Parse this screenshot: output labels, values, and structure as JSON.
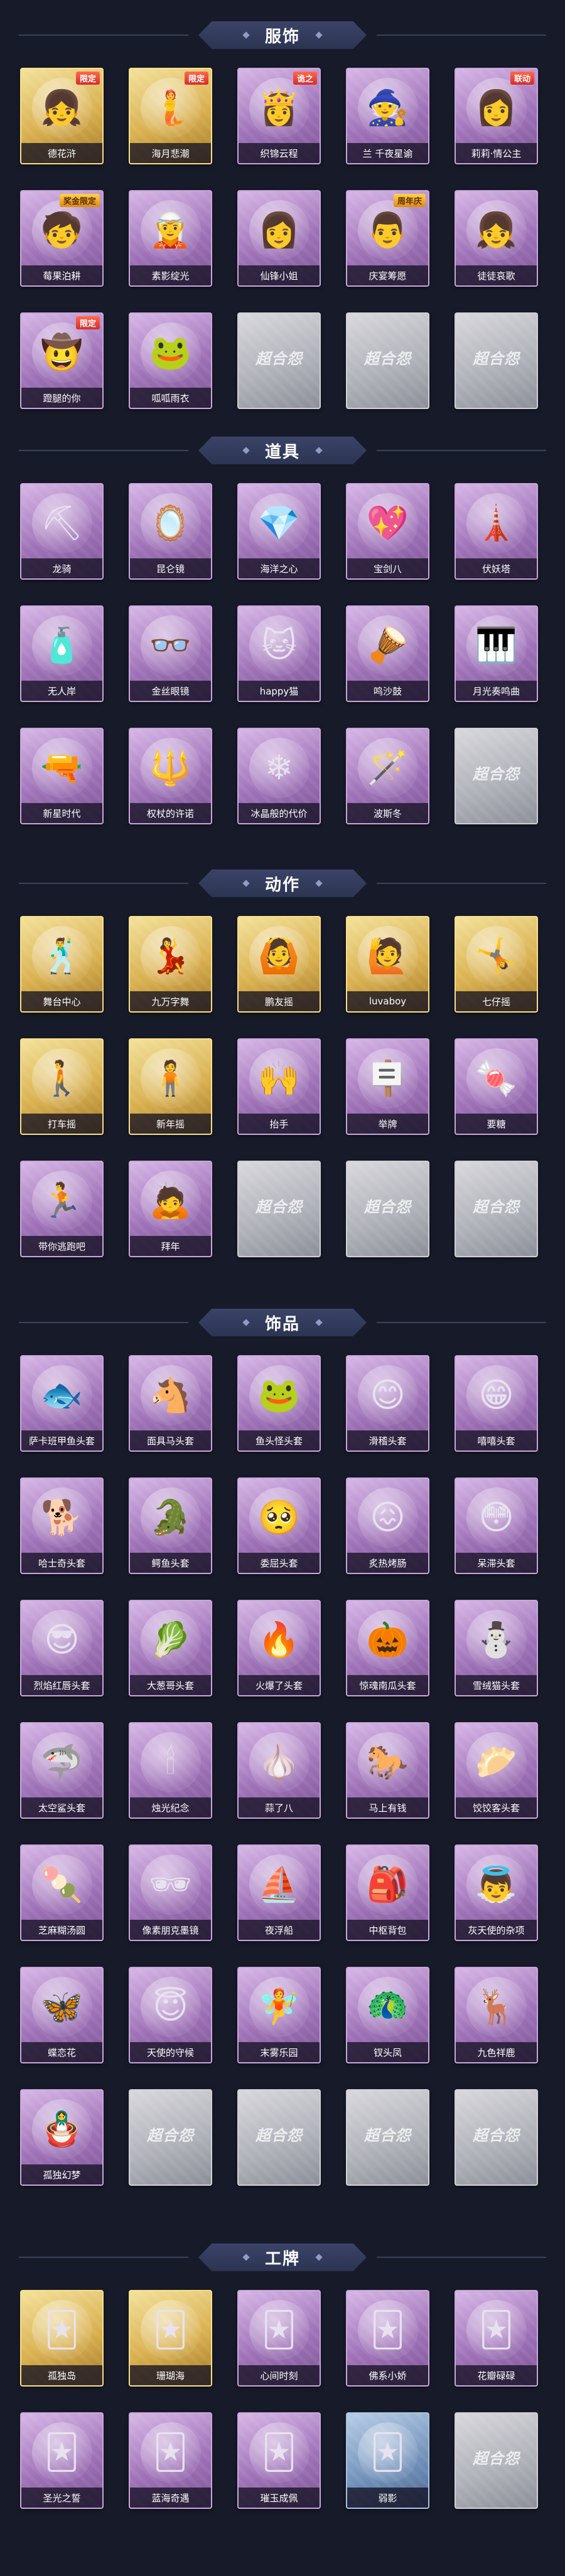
{
  "sections": [
    {
      "title": "服饰",
      "items": [
        {
          "label": "德花浒",
          "icon": "red-hood-girl-icon",
          "glyph": "👧",
          "style": "gold",
          "tag": "限定"
        },
        {
          "label": "海月悲潮",
          "icon": "mermaid-icon",
          "glyph": "🧜",
          "style": "gold",
          "tag": "限定"
        },
        {
          "label": "织锦云程",
          "icon": "white-hair-girl-icon",
          "glyph": "👸",
          "style": "purple",
          "tag": "诡之"
        },
        {
          "label": "兰 千夜星谕",
          "icon": "witch-icon",
          "glyph": "🧙",
          "style": "purple",
          "tag": ""
        },
        {
          "label": "莉莉·情公主",
          "icon": "pink-princess-icon",
          "glyph": "👩",
          "style": "purple",
          "tag": "联动"
        },
        {
          "label": "莓果泊耕",
          "icon": "berry-boy-icon",
          "glyph": "🧒",
          "style": "purple",
          "tag": "奖金限定"
        },
        {
          "label": "素影绽光",
          "icon": "silver-hair-icon",
          "glyph": "🧝",
          "style": "purple",
          "tag": ""
        },
        {
          "label": "仙锋小姐",
          "icon": "lady-icon",
          "glyph": "👩",
          "style": "purple",
          "tag": ""
        },
        {
          "label": "庆宴筹愿",
          "icon": "chef-icon",
          "glyph": "👨",
          "style": "purple",
          "tag": "周年庆"
        },
        {
          "label": "徒徒哀歌",
          "icon": "dark-girl-icon",
          "glyph": "👧",
          "style": "purple",
          "tag": ""
        },
        {
          "label": "蹬腿的你",
          "icon": "cowgirl-icon",
          "glyph": "🤠",
          "style": "purple",
          "tag": "限定"
        },
        {
          "label": "呱呱雨衣",
          "icon": "frog-raincoat-icon",
          "glyph": "🐸",
          "style": "purple",
          "tag": ""
        },
        {
          "label": "",
          "icon": "placeholder-icon",
          "glyph": "",
          "style": "gray",
          "tag": "",
          "watermark": "超合怨"
        },
        {
          "label": "",
          "icon": "placeholder-icon",
          "glyph": "",
          "style": "gray",
          "tag": "",
          "watermark": "超合怨"
        },
        {
          "label": "",
          "icon": "placeholder-icon",
          "glyph": "",
          "style": "gray",
          "tag": "",
          "watermark": "超合怨"
        }
      ]
    },
    {
      "title": "道具",
      "items": [
        {
          "label": "龙骑",
          "icon": "golden-shovel-icon",
          "glyph": "⛏",
          "style": "purple",
          "tag": ""
        },
        {
          "label": "昆仑镜",
          "icon": "mirror-icon",
          "glyph": "🪞",
          "style": "purple",
          "tag": ""
        },
        {
          "label": "海洋之心",
          "icon": "necklace-icon",
          "glyph": "💎",
          "style": "purple",
          "tag": ""
        },
        {
          "label": "宝剑八",
          "icon": "heart-badge-icon",
          "glyph": "💖",
          "style": "purple",
          "tag": ""
        },
        {
          "label": "伏妖塔",
          "icon": "pagoda-icon",
          "glyph": "🗼",
          "style": "purple",
          "tag": ""
        },
        {
          "label": "无人岸",
          "icon": "perfume-icon",
          "glyph": "🧴",
          "style": "purple",
          "tag": ""
        },
        {
          "label": "金丝眼镜",
          "icon": "glasses-icon",
          "glyph": "👓",
          "style": "purple",
          "tag": ""
        },
        {
          "label": "happy猫",
          "icon": "cat-figure-icon",
          "glyph": "🐱",
          "style": "purple",
          "tag": ""
        },
        {
          "label": "鸣沙鼓",
          "icon": "dreamcatcher-icon",
          "glyph": "🪘",
          "style": "purple",
          "tag": ""
        },
        {
          "label": "月光奏鸣曲",
          "icon": "piano-icon",
          "glyph": "🎹",
          "style": "purple",
          "tag": ""
        },
        {
          "label": "新星时代",
          "icon": "revolver-icon",
          "glyph": "🔫",
          "style": "purple",
          "tag": ""
        },
        {
          "label": "权杖的许诺",
          "icon": "scepter-icon",
          "glyph": "🔱",
          "style": "purple",
          "tag": ""
        },
        {
          "label": "冰晶般的代价",
          "icon": "ice-lotus-icon",
          "glyph": "❄",
          "style": "purple",
          "tag": ""
        },
        {
          "label": "波斯冬",
          "icon": "wand-icon",
          "glyph": "🪄",
          "style": "purple",
          "tag": ""
        },
        {
          "label": "",
          "icon": "placeholder-icon",
          "glyph": "",
          "style": "gray",
          "tag": "",
          "watermark": "超合怨"
        }
      ]
    },
    {
      "title": "动作",
      "items": [
        {
          "label": "舞台中心",
          "icon": "pose-icon",
          "glyph": "🕺",
          "style": "gold",
          "tag": ""
        },
        {
          "label": "九万字舞",
          "icon": "pose-icon",
          "glyph": "💃",
          "style": "gold",
          "tag": ""
        },
        {
          "label": "鹏友摇",
          "icon": "pose-icon",
          "glyph": "🙆",
          "style": "gold",
          "tag": ""
        },
        {
          "label": "luvaboy",
          "icon": "pose-icon",
          "glyph": "🙋",
          "style": "gold",
          "tag": ""
        },
        {
          "label": "七仔摇",
          "icon": "pose-icon",
          "glyph": "🤸",
          "style": "gold",
          "tag": ""
        },
        {
          "label": "打车摇",
          "icon": "pose-icon",
          "glyph": "🚶",
          "style": "gold",
          "tag": ""
        },
        {
          "label": "新年摇",
          "icon": "pose-icon",
          "glyph": "🧍",
          "style": "gold",
          "tag": ""
        },
        {
          "label": "抬手",
          "icon": "pose-icon",
          "glyph": "🙌",
          "style": "purple",
          "tag": ""
        },
        {
          "label": "举牌",
          "icon": "pose-icon",
          "glyph": "🪧",
          "style": "purple",
          "tag": ""
        },
        {
          "label": "要糖",
          "icon": "pose-icon",
          "glyph": "🍬",
          "style": "purple",
          "tag": ""
        },
        {
          "label": "带你逃跑吧",
          "icon": "pose-icon",
          "glyph": "🏃",
          "style": "purple",
          "tag": ""
        },
        {
          "label": "拜年",
          "icon": "pose-icon",
          "glyph": "🙇",
          "style": "purple",
          "tag": ""
        },
        {
          "label": "",
          "icon": "placeholder-icon",
          "glyph": "",
          "style": "gray",
          "tag": "",
          "watermark": "超合怨"
        },
        {
          "label": "",
          "icon": "placeholder-icon",
          "glyph": "",
          "style": "gray",
          "tag": "",
          "watermark": "超合怨"
        },
        {
          "label": "",
          "icon": "placeholder-icon",
          "glyph": "",
          "style": "gray",
          "tag": "",
          "watermark": "超合怨"
        }
      ]
    },
    {
      "title": "饰品",
      "items": [
        {
          "label": "萨卡班甲鱼头套",
          "icon": "fish-head-icon",
          "glyph": "🐟",
          "style": "purple",
          "tag": ""
        },
        {
          "label": "面具马头套",
          "icon": "horse-head-icon",
          "glyph": "🐴",
          "style": "purple",
          "tag": ""
        },
        {
          "label": "鱼头怪头套",
          "icon": "fish-monster-icon",
          "glyph": "🐸",
          "style": "purple",
          "tag": ""
        },
        {
          "label": "滑稽头套",
          "icon": "smiley-icon",
          "glyph": "😊",
          "style": "purple",
          "tag": ""
        },
        {
          "label": "嘻嘻头套",
          "icon": "grin-icon",
          "glyph": "😁",
          "style": "purple",
          "tag": ""
        },
        {
          "label": "哈士奇头套",
          "icon": "husky-icon",
          "glyph": "🐕",
          "style": "purple",
          "tag": ""
        },
        {
          "label": "鳄鱼头套",
          "icon": "crocodile-icon",
          "glyph": "🐊",
          "style": "purple",
          "tag": ""
        },
        {
          "label": "委屈头套",
          "icon": "sad-face-icon",
          "glyph": "🥺",
          "style": "purple",
          "tag": ""
        },
        {
          "label": "炙热烤肠",
          "icon": "sausage-icon",
          "glyph": "😖",
          "style": "purple",
          "tag": ""
        },
        {
          "label": "呆滞头套",
          "icon": "dazed-face-icon",
          "glyph": "😳",
          "style": "purple",
          "tag": ""
        },
        {
          "label": "烈焰红唇头套",
          "icon": "lips-icon",
          "glyph": "😎",
          "style": "purple",
          "tag": ""
        },
        {
          "label": "大葱哥头套",
          "icon": "scallion-icon",
          "glyph": "🥬",
          "style": "purple",
          "tag": ""
        },
        {
          "label": "火爆了头套",
          "icon": "fire-icon",
          "glyph": "🔥",
          "style": "purple",
          "tag": ""
        },
        {
          "label": "惊魂南瓜头套",
          "icon": "pumpkin-icon",
          "glyph": "🎃",
          "style": "purple",
          "tag": ""
        },
        {
          "label": "雪绒猫头套",
          "icon": "snow-cat-icon",
          "glyph": "⛄",
          "style": "purple",
          "tag": ""
        },
        {
          "label": "太空鲨头套",
          "icon": "shark-icon",
          "glyph": "🦈",
          "style": "purple",
          "tag": ""
        },
        {
          "label": "烛光纪念",
          "icon": "candle-icon",
          "glyph": "🕯",
          "style": "purple",
          "tag": ""
        },
        {
          "label": "蒜了八",
          "icon": "garlic-icon",
          "glyph": "🧄",
          "style": "purple",
          "tag": ""
        },
        {
          "label": "马上有钱",
          "icon": "money-horse-icon",
          "glyph": "🐎",
          "style": "purple",
          "tag": ""
        },
        {
          "label": "饺饺客头套",
          "icon": "dumpling-icon",
          "glyph": "🥟",
          "style": "purple",
          "tag": ""
        },
        {
          "label": "芝麻糊汤圆",
          "icon": "tangyuan-icon",
          "glyph": "🍡",
          "style": "purple",
          "tag": ""
        },
        {
          "label": "像素朋克墨镜",
          "icon": "pixel-sunglasses-icon",
          "glyph": "🕶",
          "style": "purple",
          "tag": ""
        },
        {
          "label": "夜浮船",
          "icon": "night-ship-icon",
          "glyph": "⛵",
          "style": "purple",
          "tag": ""
        },
        {
          "label": "中枢背包",
          "icon": "backpack-icon",
          "glyph": "🎒",
          "style": "purple",
          "tag": ""
        },
        {
          "label": "灰天使的杂项",
          "icon": "angel-doll-icon",
          "glyph": "👼",
          "style": "purple",
          "tag": ""
        },
        {
          "label": "蝶恋花",
          "icon": "butterfly-icon",
          "glyph": "🦋",
          "style": "purple",
          "tag": ""
        },
        {
          "label": "天使的守候",
          "icon": "angel-icon",
          "glyph": "😇",
          "style": "purple",
          "tag": ""
        },
        {
          "label": "末雾乐园",
          "icon": "fairy-icon",
          "glyph": "🧚",
          "style": "purple",
          "tag": ""
        },
        {
          "label": "钗头凤",
          "icon": "phoenix-icon",
          "glyph": "🦚",
          "style": "purple",
          "tag": ""
        },
        {
          "label": "九色祥鹿",
          "icon": "deer-icon",
          "glyph": "🦌",
          "style": "purple",
          "tag": ""
        },
        {
          "label": "孤独幻梦",
          "icon": "dream-doll-icon",
          "glyph": "🪆",
          "style": "purple",
          "tag": ""
        },
        {
          "label": "",
          "icon": "placeholder-icon",
          "glyph": "",
          "style": "gray",
          "tag": "",
          "watermark": "超合怨"
        },
        {
          "label": "",
          "icon": "placeholder-icon",
          "glyph": "",
          "style": "gray",
          "tag": "",
          "watermark": "超合怨"
        },
        {
          "label": "",
          "icon": "placeholder-icon",
          "glyph": "",
          "style": "gray",
          "tag": "",
          "watermark": "超合怨"
        },
        {
          "label": "",
          "icon": "placeholder-icon",
          "glyph": "",
          "style": "gray",
          "tag": "",
          "watermark": "超合怨"
        }
      ]
    },
    {
      "title": "工牌",
      "items": [
        {
          "label": "孤独岛",
          "icon": "card-badge-icon",
          "glyph": "🃏",
          "style": "gold",
          "tag": ""
        },
        {
          "label": "珊瑚海",
          "icon": "card-badge-icon",
          "glyph": "🃏",
          "style": "gold",
          "tag": ""
        },
        {
          "label": "心间时刻",
          "icon": "card-badge-icon",
          "glyph": "🃏",
          "style": "purple",
          "tag": ""
        },
        {
          "label": "佛系小娇",
          "icon": "card-badge-icon",
          "glyph": "🃏",
          "style": "purple",
          "tag": ""
        },
        {
          "label": "花瓣碌碌",
          "icon": "card-badge-icon",
          "glyph": "🃏",
          "style": "purple",
          "tag": ""
        },
        {
          "label": "圣光之誓",
          "icon": "card-badge-icon",
          "glyph": "🃏",
          "style": "purple",
          "tag": ""
        },
        {
          "label": "蓝海奇遇",
          "icon": "card-badge-icon",
          "glyph": "🃏",
          "style": "purple",
          "tag": ""
        },
        {
          "label": "璀玉成佩",
          "icon": "card-badge-icon",
          "glyph": "🃏",
          "style": "purple",
          "tag": ""
        },
        {
          "label": "弱影",
          "icon": "card-badge-icon",
          "glyph": "🃏",
          "style": "blue",
          "tag": ""
        },
        {
          "label": "",
          "icon": "placeholder-icon",
          "glyph": "",
          "style": "gray",
          "tag": "",
          "watermark": "超合怨"
        }
      ]
    }
  ]
}
